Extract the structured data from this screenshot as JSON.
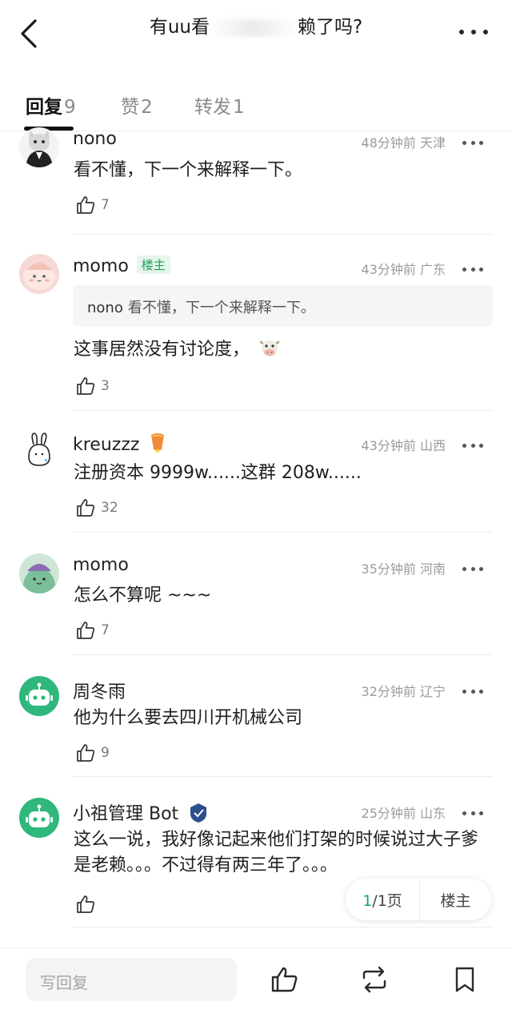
{
  "header": {
    "title_start": "有uu看",
    "title_end": "赖了吗?"
  },
  "tabs": [
    {
      "label": "回复",
      "count": "9"
    },
    {
      "label": "赞",
      "count": "2"
    },
    {
      "label": "转发",
      "count": "1"
    }
  ],
  "replies": [
    {
      "user": "nono",
      "time": "48分钟前",
      "location": "天津",
      "text": "看不懂，下一个来解释一下。",
      "likes": "7"
    },
    {
      "user": "momo",
      "badge": "楼主",
      "time": "43分钟前",
      "location": "广东",
      "quote_user": "nono",
      "quote_text": "看不懂，下一个来解释一下。",
      "text": "这事居然没有讨论度，",
      "likes": "3"
    },
    {
      "user": "kreuzzz",
      "time": "43分钟前",
      "location": "山西",
      "text": "注册资本 9999w......这群 208w......",
      "likes": "32"
    },
    {
      "user": "momo",
      "time": "35分钟前",
      "location": "河南",
      "text": "怎么不算呢 ~~~",
      "likes": "7"
    },
    {
      "user": "周冬雨",
      "time": "32分钟前",
      "location": "辽宁",
      "text": "他为什么要去四川开机械公司",
      "likes": "9"
    },
    {
      "user": "小祖管理 Bot",
      "time": "25分钟前",
      "location": "山东",
      "text": "这么一说，我好像记起来他们打架的时候说过大子爹是老赖。。。不过得有两三年了。。。",
      "likes": ""
    }
  ],
  "pager": {
    "current": "1",
    "total": "/1页",
    "owner": "楼主"
  },
  "bottom": {
    "reply_placeholder": "写回复"
  },
  "colors": {
    "accent": "#14a85a",
    "badge_bg": "#e6f6ec",
    "bot_avatar": "#2fb77c"
  }
}
